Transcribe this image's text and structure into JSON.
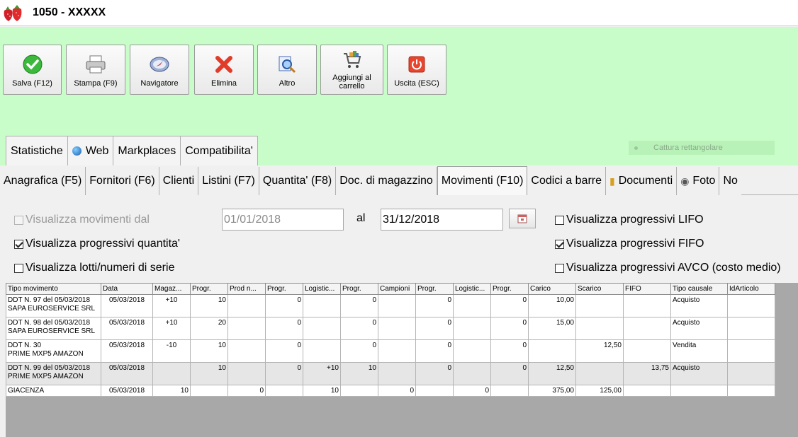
{
  "window": {
    "title": "1050 - XXXXX"
  },
  "toolbar": [
    {
      "label": "Salva (F12)",
      "icon": "check-icon"
    },
    {
      "label": "Stampa (F9)",
      "icon": "printer-icon"
    },
    {
      "label": "Navigatore",
      "icon": "compass-icon"
    },
    {
      "label": "Elimina",
      "icon": "delete-x-icon"
    },
    {
      "label": "Altro",
      "icon": "magnifier-icon"
    },
    {
      "label": "Aggiungi al carrello",
      "icon": "cart-icon"
    },
    {
      "label": "Uscita (ESC)",
      "icon": "power-icon"
    }
  ],
  "cattura_label": "Cattura rettangolare",
  "subtabs": [
    "Statistiche",
    "Web",
    "Markplaces",
    "Compatibilita'"
  ],
  "tabs": [
    "Anagrafica (F5)",
    "Fornitori (F6)",
    "Clienti",
    "Listini (F7)",
    "Quantita' (F8)",
    "Doc. di magazzino",
    "Movimenti (F10)",
    "Codici a barre",
    "Documenti",
    "Foto",
    "No"
  ],
  "filters": {
    "visualizza_movimenti_dal": "Visualizza movimenti dal",
    "date_from": "01/01/2018",
    "al": "al",
    "date_to": "31/12/2018",
    "progressivi_quantita": "Visualizza progressivi quantita'",
    "lotti": "Visualizza lotti/numeri di serie",
    "lifo": "Visualizza progressivi LIFO",
    "fifo": "Visualizza progressivi FIFO",
    "avco": "Visualizza progressivi AVCO (costo medio)"
  },
  "grid": {
    "columns": [
      "Tipo movimento",
      "Data",
      "Magaz...",
      "Progr.",
      "Prod n...",
      "Progr.",
      "Logistic...",
      "Progr.",
      "Campioni",
      "Progr.",
      "Logistic...",
      "Progr.",
      "Carico",
      "Scarico",
      "FIFO",
      "Tipo causale",
      "IdArticolo"
    ],
    "rows": [
      {
        "tipo1": "DDT N. 97 del 05/03/2018",
        "tipo2": "SAPA EUROSERVICE SRL",
        "data": "05/03/2018",
        "mag": "+10",
        "p1": "10",
        "prod": "",
        "p2": "0",
        "log1": "",
        "p3": "0",
        "camp": "",
        "p4": "0",
        "log2": "",
        "p5": "0",
        "carico": "10,00",
        "scarico": "",
        "fifo": "",
        "causale": "Acquisto",
        "id": ""
      },
      {
        "tipo1": "DDT N. 98 del 05/03/2018",
        "tipo2": "SAPA EUROSERVICE SRL",
        "data": "05/03/2018",
        "mag": "+10",
        "p1": "20",
        "prod": "",
        "p2": "0",
        "log1": "",
        "p3": "0",
        "camp": "",
        "p4": "0",
        "log2": "",
        "p5": "0",
        "carico": "15,00",
        "scarico": "",
        "fifo": "",
        "causale": "Acquisto",
        "id": ""
      },
      {
        "tipo1": "DDT N. 30",
        "tipo2": "PRIME MXP5 AMAZON",
        "data": "05/03/2018",
        "mag": "-10",
        "p1": "10",
        "prod": "",
        "p2": "0",
        "log1": "",
        "p3": "0",
        "camp": "",
        "p4": "0",
        "log2": "",
        "p5": "0",
        "carico": "",
        "scarico": "12,50",
        "fifo": "",
        "causale": "Vendita",
        "id": ""
      },
      {
        "tipo1": "DDT N. 99 del 05/03/2018",
        "tipo2": "PRIME MXP5 AMAZON",
        "data": "05/03/2018",
        "mag": "",
        "p1": "10",
        "prod": "",
        "p2": "0",
        "log1": "+10",
        "p3": "10",
        "camp": "",
        "p4": "0",
        "log2": "",
        "p5": "0",
        "carico": "12,50",
        "scarico": "",
        "fifo": "13,75",
        "causale": "Acquisto",
        "id": ""
      }
    ],
    "giacenza": {
      "tipo": "GIACENZA",
      "data": "05/03/2018",
      "mag": "10",
      "p1": "",
      "prod": "0",
      "p2": "",
      "log1": "10",
      "p3": "",
      "camp": "0",
      "p4": "",
      "log2": "0",
      "p5": "",
      "carico": "375,00",
      "scarico": "125,00",
      "fifo": "",
      "causale": "",
      "id": ""
    }
  }
}
